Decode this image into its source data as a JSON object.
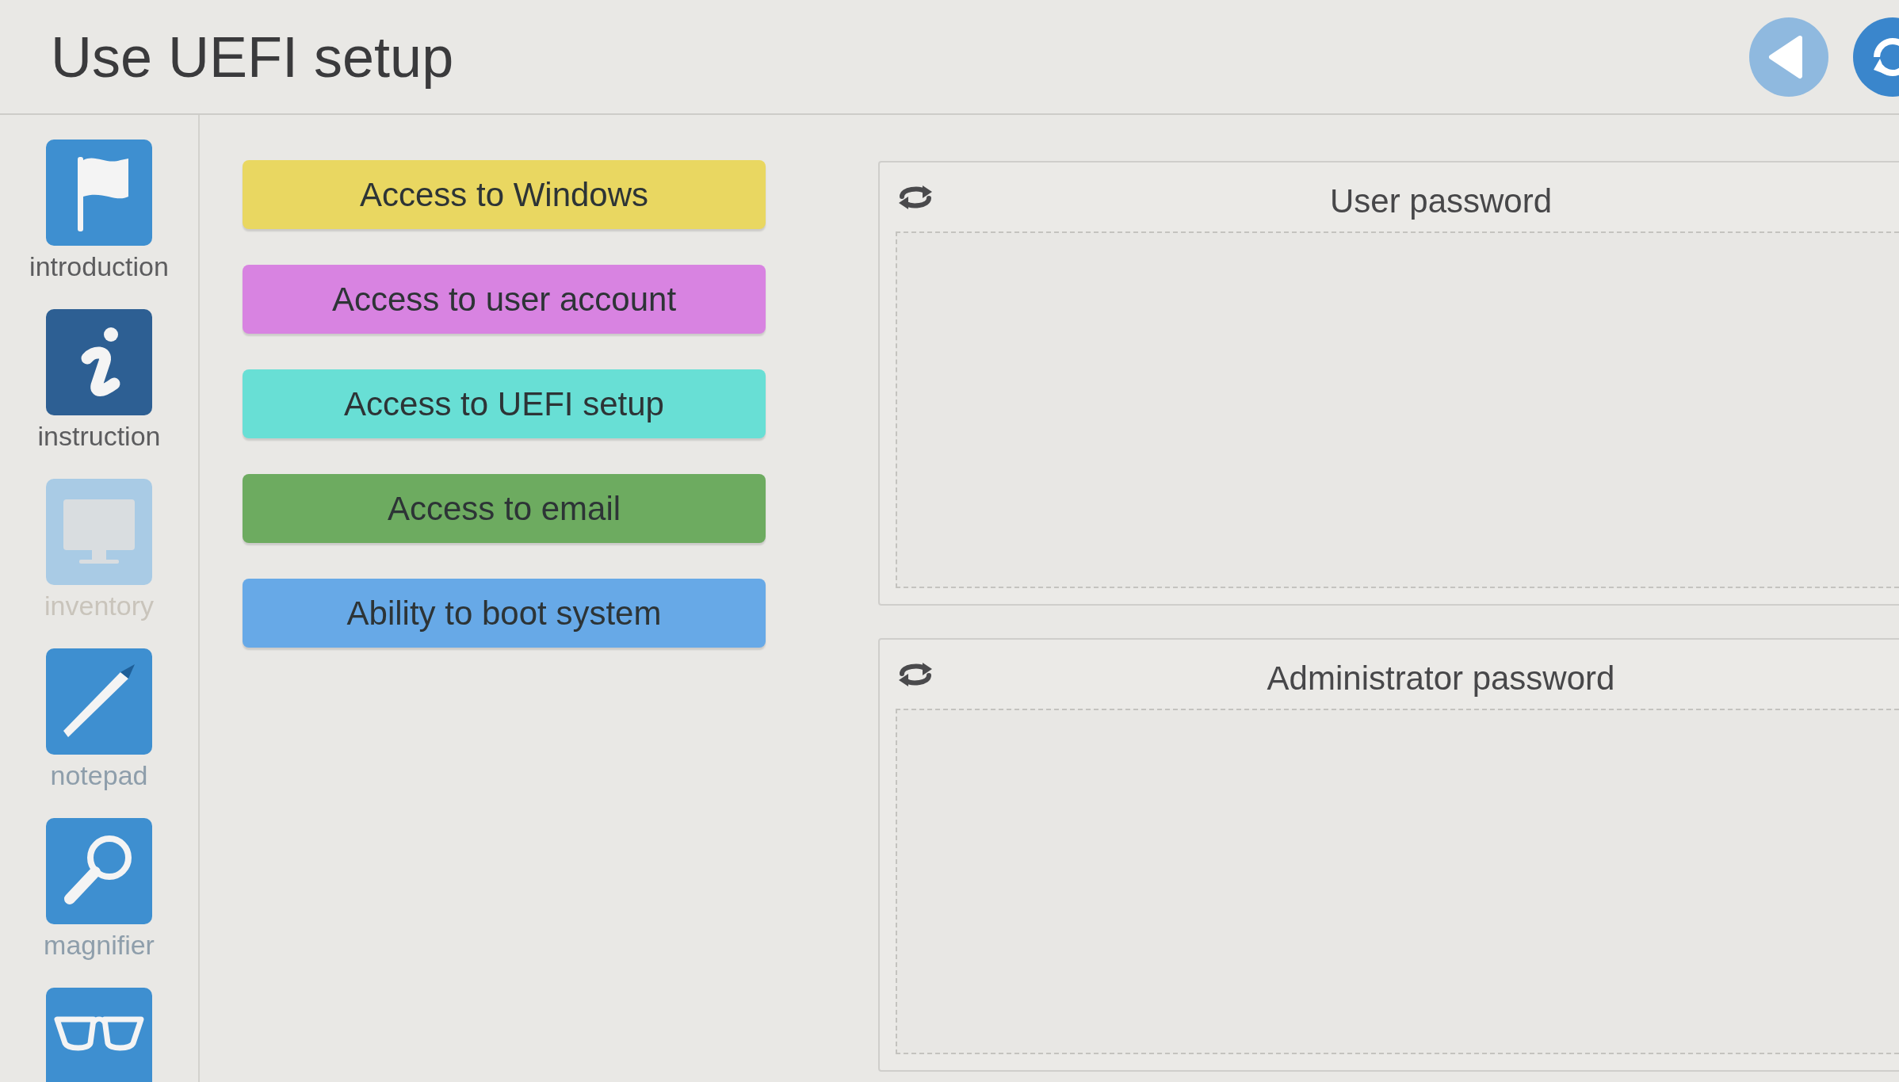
{
  "title": "Use UEFI setup",
  "header_buttons": [
    {
      "kind": "back",
      "disabled": true
    },
    {
      "kind": "reset",
      "disabled": false
    }
  ],
  "sidebar": {
    "items": [
      {
        "label": "introduction",
        "selected": false,
        "disabled": false,
        "visited": true
      },
      {
        "label": "instruction",
        "selected": true,
        "disabled": false,
        "visited": true
      },
      {
        "label": "inventory",
        "selected": false,
        "disabled": true,
        "visited": false
      },
      {
        "label": "notepad",
        "selected": false,
        "disabled": false,
        "visited": false
      },
      {
        "label": "magnifier",
        "selected": false,
        "disabled": false,
        "visited": false
      },
      {
        "selected": false,
        "disabled": false
      }
    ]
  },
  "answers": [
    {
      "label": "Access to Windows",
      "color": "#e9d761"
    },
    {
      "label": "Access to user account",
      "color": "#d883e1"
    },
    {
      "label": "Access to UEFI setup",
      "color": "#68dfd5"
    },
    {
      "label": "Access to email",
      "color": "#6dab60"
    },
    {
      "label": "Ability to boot system",
      "color": "#67a9e7"
    }
  ],
  "drop_zones": [
    {
      "title": "User password"
    },
    {
      "title": "Administrator password"
    }
  ]
}
